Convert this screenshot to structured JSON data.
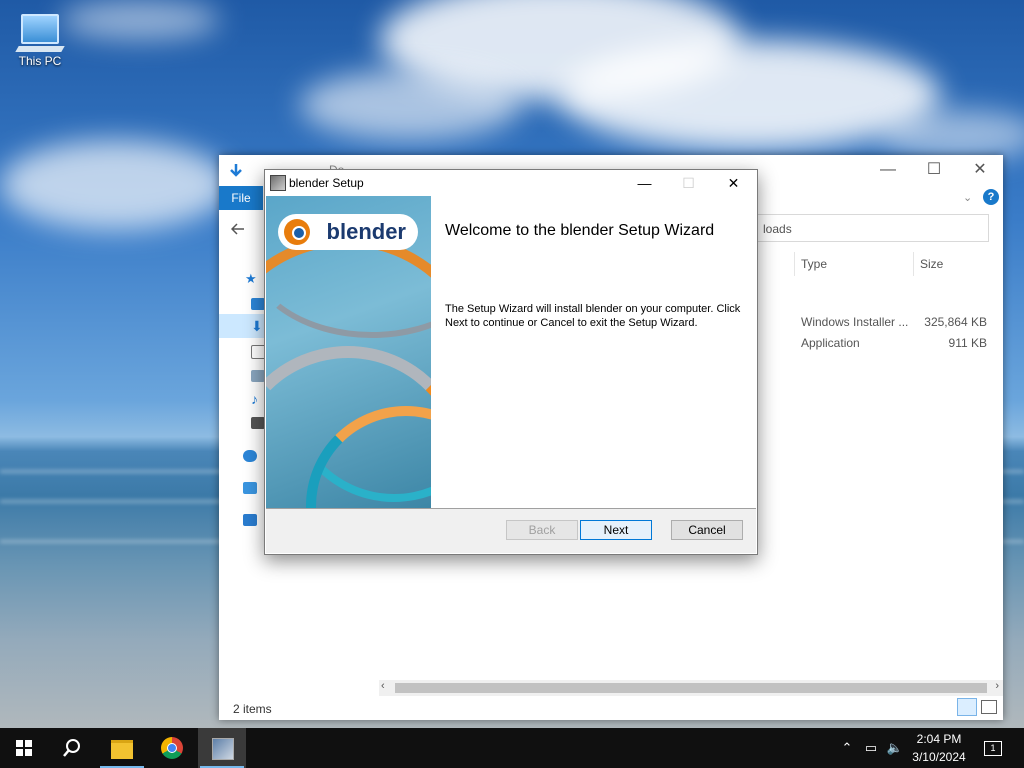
{
  "desktop": {
    "icons": [
      {
        "label": "This PC"
      }
    ]
  },
  "explorer": {
    "file_tab": "File",
    "title_fragment": "Do ...",
    "address_fragment": "loads",
    "columns": {
      "type": "Type",
      "size": "Size"
    },
    "rows": [
      {
        "type": "Windows Installer ...",
        "size": "325,864 KB"
      },
      {
        "type": "Application",
        "size": "911 KB"
      }
    ],
    "status": "2 items",
    "controls": {
      "minimize": "—",
      "maximize": "☐",
      "close": "✕"
    },
    "help": "?"
  },
  "setup": {
    "window_title": "blender Setup",
    "logo_text": "blender",
    "heading": "Welcome to the blender Setup Wizard",
    "body": "The Setup Wizard will install blender on your computer. Click Next to continue or Cancel to exit the Setup Wizard.",
    "buttons": {
      "back": "Back",
      "next": "Next",
      "cancel": "Cancel"
    },
    "controls": {
      "minimize": "—",
      "maximize": "☐",
      "close": "✕"
    }
  },
  "taskbar": {
    "time": "2:04 PM",
    "date": "3/10/2024",
    "notification_count": "1",
    "pinned": [
      "start",
      "search",
      "file-explorer",
      "chrome",
      "blender-installer"
    ]
  },
  "colors": {
    "accent": "#0078d7",
    "ribbon_file": "#1979ca",
    "taskbar": "#101010"
  }
}
